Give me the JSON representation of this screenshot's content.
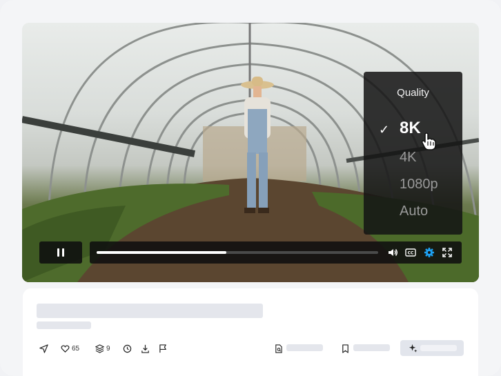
{
  "player": {
    "quality_menu": {
      "title": "Quality",
      "options": [
        {
          "label": "8K",
          "selected": true
        },
        {
          "label": "4K",
          "selected": false
        },
        {
          "label": "1080p",
          "selected": false
        },
        {
          "label": "Auto",
          "selected": false
        }
      ]
    },
    "progress": 0.46,
    "icons": [
      "pause-icon",
      "volume-icon",
      "closed-captions-icon",
      "settings-gear-icon",
      "fullscreen-icon"
    ]
  },
  "actions": {
    "likes": "65",
    "layers": "9"
  },
  "colors": {
    "accent": "#1da1f2",
    "skeleton": "#e4e6ec",
    "menu_bg": "#141414"
  }
}
